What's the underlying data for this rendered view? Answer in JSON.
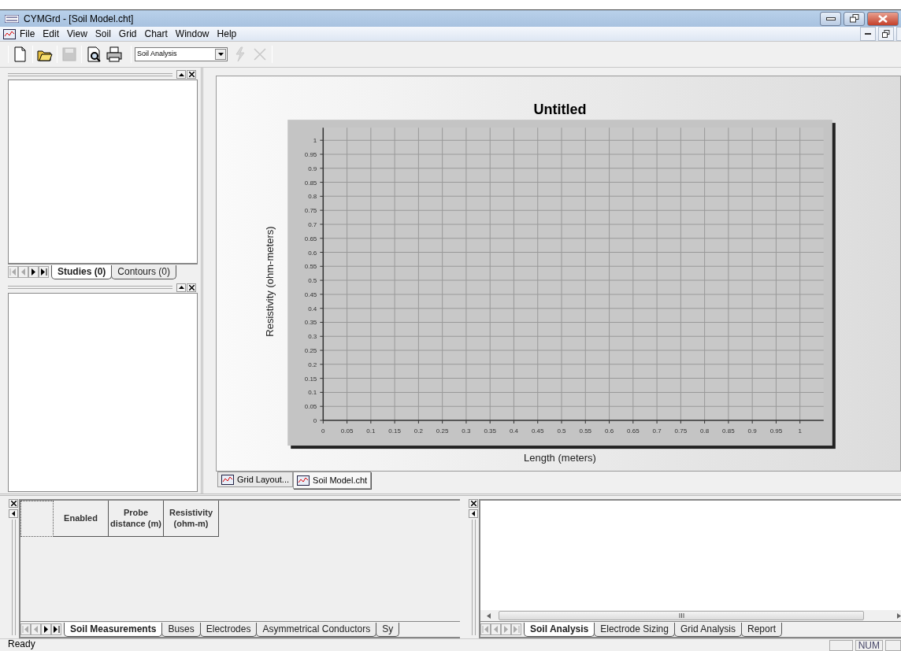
{
  "window": {
    "title": "CYMGrd - [Soil Model.cht]"
  },
  "menu": [
    "File",
    "Edit",
    "View",
    "Soil",
    "Grid",
    "Chart",
    "Window",
    "Help"
  ],
  "toolbar": {
    "buttons": [
      {
        "kind": "new",
        "disabled": false
      },
      {
        "kind": "open",
        "disabled": false
      },
      {
        "kind": "save",
        "disabled": true
      },
      {
        "kind": "preview",
        "disabled": false
      },
      {
        "kind": "print",
        "disabled": false
      }
    ],
    "combo": {
      "value": "Soil Analysis"
    },
    "actions": [
      {
        "kind": "run",
        "disabled": true
      },
      {
        "kind": "cancel",
        "disabled": true
      }
    ]
  },
  "left_top_panel": {
    "nav": [
      {
        "kind": "first",
        "disabled": true
      },
      {
        "kind": "prev",
        "disabled": true
      },
      {
        "kind": "next",
        "disabled": false
      },
      {
        "kind": "last",
        "disabled": false
      }
    ],
    "tabs": [
      {
        "label": "Studies (0)",
        "selected": true
      },
      {
        "label": "Contours (0)",
        "selected": false
      }
    ]
  },
  "chart": {
    "chart_data": {
      "type": "line",
      "title": "Untitled",
      "xlabel": "Length (meters)",
      "ylabel": "Resistivity (ohm-meters)",
      "xlim": [
        0,
        1
      ],
      "ylim": [
        0,
        1
      ],
      "grid": true,
      "xticks": [
        0,
        0.05,
        0.1,
        0.15,
        0.2,
        0.25,
        0.3,
        0.35,
        0.4,
        0.45,
        0.5,
        0.55,
        0.6,
        0.65,
        0.7,
        0.75,
        0.8,
        0.85,
        0.9,
        0.95,
        1
      ],
      "yticks": [
        0,
        0.05,
        0.1,
        0.15,
        0.2,
        0.25,
        0.3,
        0.35,
        0.4,
        0.45,
        0.5,
        0.55,
        0.6,
        0.65,
        0.7,
        0.75,
        0.8,
        0.85,
        0.9,
        0.95,
        1
      ]
    }
  },
  "document_tabs": [
    {
      "label": "Grid Layout...",
      "selected": false
    },
    {
      "label": "Soil Model.cht",
      "selected": true
    }
  ],
  "measurements_table": {
    "columns": [
      "Enabled",
      "Probe distance (m)",
      "Resistivity (ohm-m)"
    ]
  },
  "bottom_left_panel": {
    "nav": [
      {
        "kind": "first",
        "disabled": true
      },
      {
        "kind": "prev",
        "disabled": true
      },
      {
        "kind": "next",
        "disabled": false
      },
      {
        "kind": "last",
        "disabled": false
      }
    ],
    "tabs": [
      {
        "label": "Soil Measurements",
        "selected": true
      },
      {
        "label": "Buses",
        "selected": false
      },
      {
        "label": "Electrodes",
        "selected": false
      },
      {
        "label": "Asymmetrical Conductors",
        "selected": false
      },
      {
        "label": "Sy",
        "selected": false
      }
    ]
  },
  "bottom_right_panel": {
    "nav": [
      {
        "kind": "first",
        "disabled": true
      },
      {
        "kind": "prev",
        "disabled": true
      },
      {
        "kind": "next",
        "disabled": true
      },
      {
        "kind": "last",
        "disabled": true
      }
    ],
    "tabs": [
      {
        "label": "Soil Analysis",
        "selected": true
      },
      {
        "label": "Electrode Sizing",
        "selected": false
      },
      {
        "label": "Grid Analysis",
        "selected": false
      },
      {
        "label": "Report",
        "selected": false
      }
    ]
  },
  "status_bar": {
    "message": "Ready",
    "indicators": [
      "NUM"
    ]
  }
}
